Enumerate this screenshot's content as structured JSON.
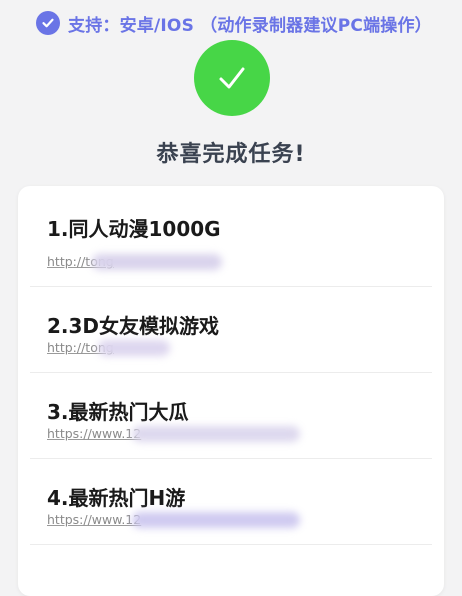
{
  "banner": {
    "icon": "check-circle-icon",
    "text": "支持：安卓/IOS （动作录制器建议PC端操作）",
    "color": "#6a74e6"
  },
  "success": {
    "icon": "checkmark-icon",
    "title": "恭喜完成任务!",
    "color": "#47d647"
  },
  "items": [
    {
      "title": "1.同人动漫1000G",
      "link": "http://tong"
    },
    {
      "title": "2.3D女友模拟游戏",
      "link": "http://tong"
    },
    {
      "title": "3.最新热门大瓜",
      "link": "https://www.12"
    },
    {
      "title": "4.最新热门H游",
      "link": "https://www.12"
    }
  ]
}
